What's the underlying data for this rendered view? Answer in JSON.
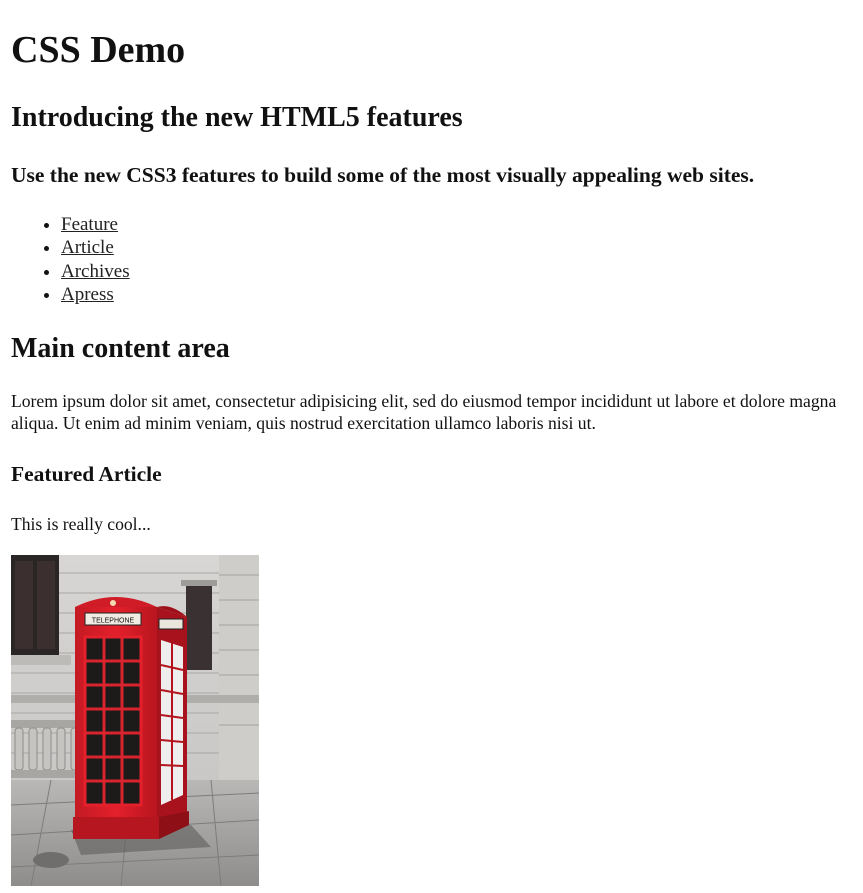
{
  "header": {
    "title": "CSS Demo",
    "subtitle": "Introducing the new HTML5 features",
    "tagline": "Use the new CSS3 features to build some of the most visually appealing web sites."
  },
  "nav": {
    "items": [
      {
        "label": "Feature"
      },
      {
        "label": "Article"
      },
      {
        "label": "Archives"
      },
      {
        "label": "Apress"
      }
    ]
  },
  "main": {
    "heading": "Main content area",
    "body": "Lorem ipsum dolor sit amet, consectetur adipisicing elit, sed do eiusmod tempor incididunt ut labore et dolore magna aliqua. Ut enim ad minim veniam, quis nostrud exercitation ullamco laboris nisi ut.",
    "featured": {
      "heading": "Featured Article",
      "text": "This is really cool...",
      "image": {
        "subject": "red telephone box",
        "sign_text": "TELEPHONE",
        "box_color": "#e3202b"
      }
    }
  }
}
